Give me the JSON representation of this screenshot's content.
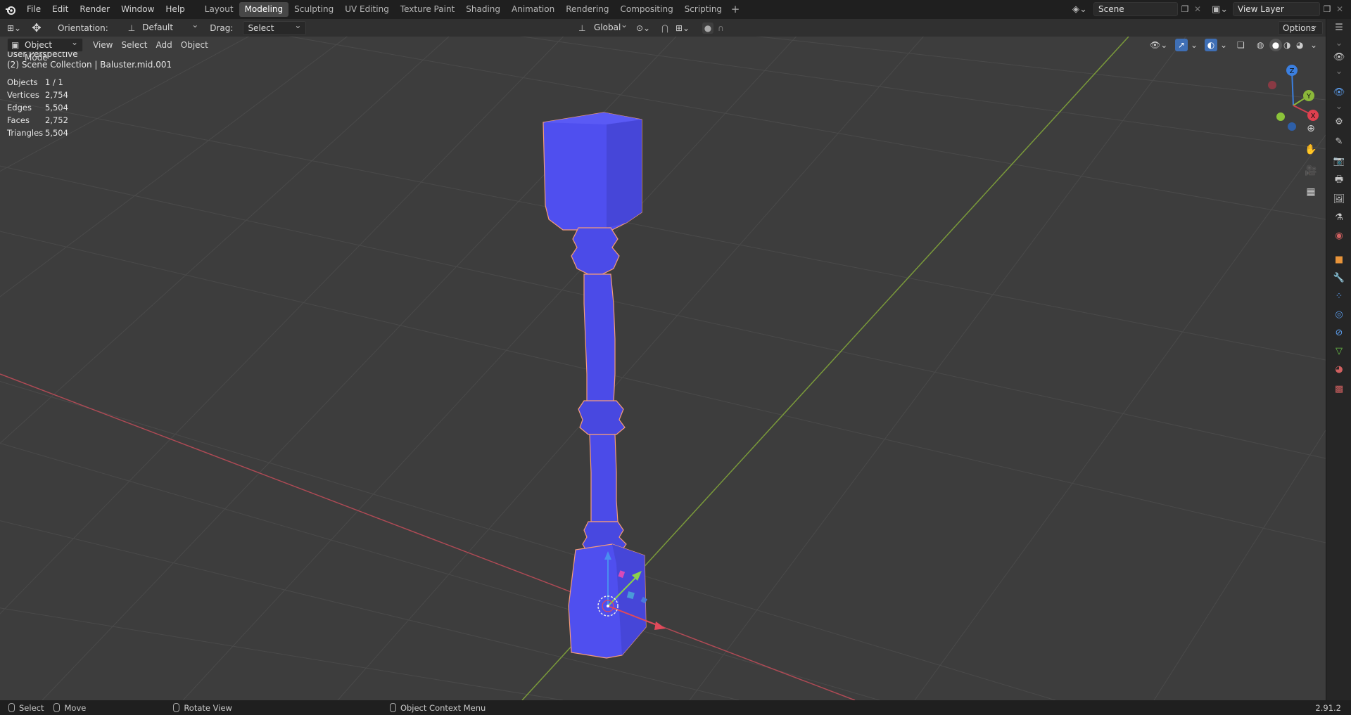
{
  "topbar": {
    "menus": [
      "File",
      "Edit",
      "Render",
      "Window",
      "Help"
    ],
    "workspaces": [
      "Layout",
      "Modeling",
      "Sculpting",
      "UV Editing",
      "Texture Paint",
      "Shading",
      "Animation",
      "Rendering",
      "Compositing",
      "Scripting"
    ],
    "active_workspace": "Modeling",
    "scene": "Scene",
    "view_layer": "View Layer"
  },
  "toolbar": {
    "orientation_label": "Orientation:",
    "orientation_value": "Default",
    "drag_label": "Drag:",
    "drag_value": "Select Box",
    "transform_orientation": "Global",
    "options_label": "Options"
  },
  "viewport_header": {
    "mode": "Object Mode",
    "menus": [
      "View",
      "Select",
      "Add",
      "Object"
    ]
  },
  "viewport": {
    "perspective": "User Perspective",
    "collection": "(2) Scene Collection | Baluster.mid.001",
    "stats": [
      {
        "label": "Objects",
        "value": "1 / 1"
      },
      {
        "label": "Vertices",
        "value": "2,754"
      },
      {
        "label": "Edges",
        "value": "5,504"
      },
      {
        "label": "Faces",
        "value": "2,752"
      },
      {
        "label": "Triangles",
        "value": "5,504"
      }
    ],
    "gizmo_axes": {
      "x": "X",
      "y": "Y",
      "z": "Z"
    },
    "colors": {
      "x_axis": "#c3404f",
      "y_axis": "#7da82b",
      "z_axis": "#2f75d8",
      "object": "#4f4fef",
      "selection_outline": "#f59c7a"
    }
  },
  "statusbar": {
    "items": [
      "Select",
      "Move",
      "Rotate View",
      "Object Context Menu"
    ],
    "version": "2.91.2"
  }
}
